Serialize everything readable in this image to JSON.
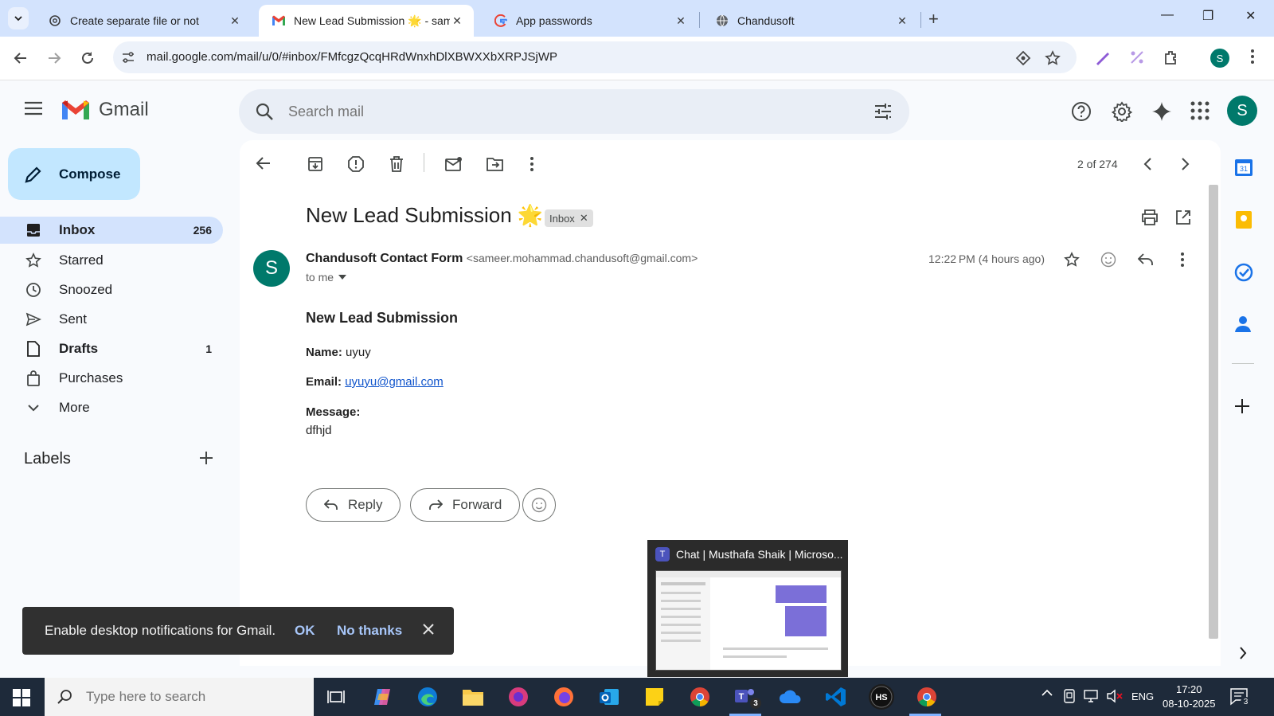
{
  "browser": {
    "tabs": [
      {
        "title": "Create separate file or not",
        "icon": "openai-icon"
      },
      {
        "title": "New Lead Submission 🌟 - sam",
        "icon": "gmail-icon"
      },
      {
        "title": "App passwords",
        "icon": "google-icon"
      },
      {
        "title": "Chandusoft",
        "icon": "globe-icon"
      }
    ],
    "url": "mail.google.com/mail/u/0/#inbox/FMfcgzQcqHRdWnxhDlXBWXXbXRPJSjWP",
    "profile_initial": "S"
  },
  "gmail": {
    "logo_text": "Gmail",
    "search_placeholder": "Search mail",
    "avatar_initial": "S",
    "compose_label": "Compose",
    "nav": [
      {
        "label": "Inbox",
        "count": "256",
        "icon": "inbox-icon"
      },
      {
        "label": "Starred",
        "count": "",
        "icon": "star-icon"
      },
      {
        "label": "Snoozed",
        "count": "",
        "icon": "clock-icon"
      },
      {
        "label": "Sent",
        "count": "",
        "icon": "send-icon"
      },
      {
        "label": "Drafts",
        "count": "1",
        "icon": "draft-icon"
      },
      {
        "label": "Purchases",
        "count": "",
        "icon": "bag-icon"
      },
      {
        "label": "More",
        "count": "",
        "icon": "chevron-down-icon"
      }
    ],
    "labels_heading": "Labels"
  },
  "message": {
    "pagination": "2 of 274",
    "subject": "New Lead Submission 🌟",
    "label_chip": "Inbox",
    "sender_name": "Chandusoft Contact Form",
    "sender_email": "<sameer.mohammad.chandusoft@gmail.com>",
    "sender_initial": "S",
    "recipient": "to me",
    "time": "12:22 PM (4 hours ago)",
    "body_heading": "New Lead Submission",
    "name_label": "Name:",
    "name_value": "uyuy",
    "email_label": "Email:",
    "email_value": "uyuyu@gmail.com",
    "message_label": "Message:",
    "message_value": "dfhjd",
    "reply_label": "Reply",
    "forward_label": "Forward"
  },
  "snackbar": {
    "text": "Enable desktop notifications for Gmail.",
    "ok_label": "OK",
    "no_label": "No thanks"
  },
  "preview": {
    "title": "Chat | Musthafa Shaik | Microso..."
  },
  "taskbar": {
    "search_placeholder": "Type here to search",
    "teams_badge": "3",
    "lang": "ENG",
    "time": "17:20",
    "date": "08-10-2025",
    "notif_count": "3"
  }
}
